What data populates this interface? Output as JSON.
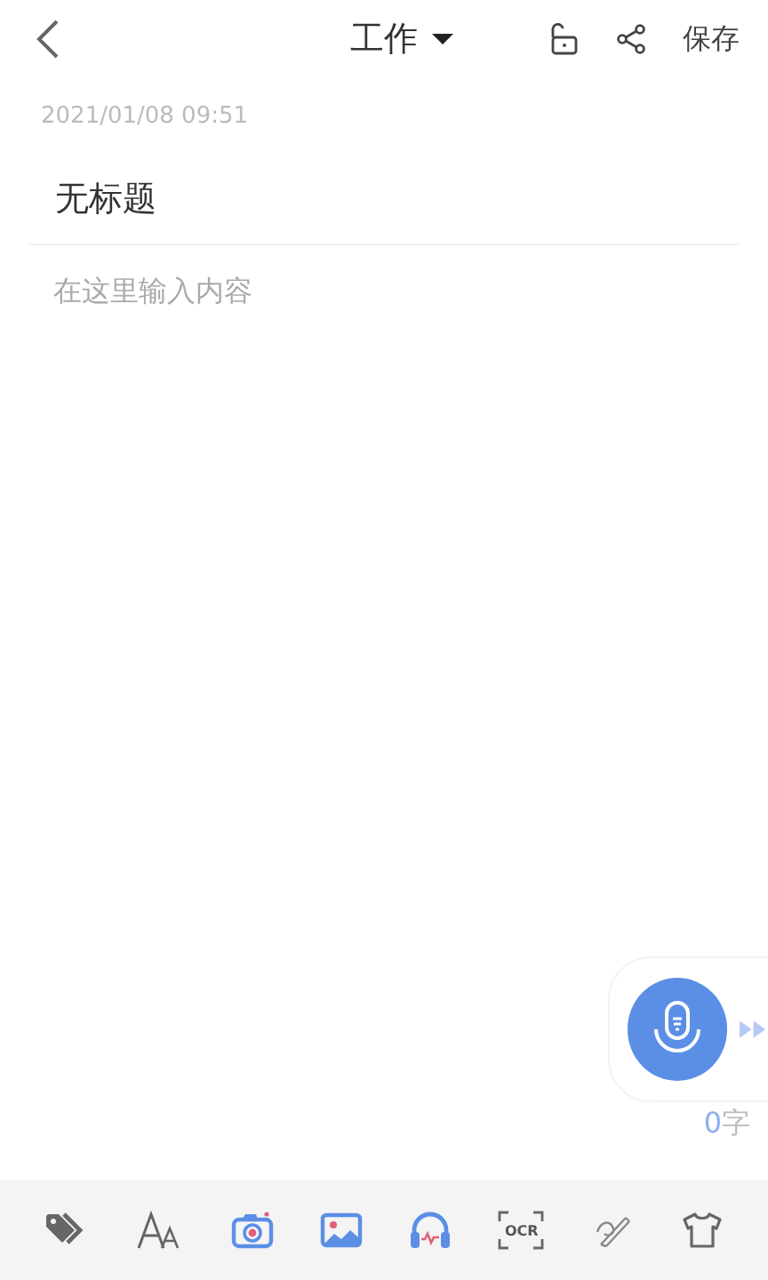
{
  "header": {
    "category": "工作",
    "save": "保存",
    "locked": false
  },
  "date": "2021/01/08 09:51",
  "title": "无标题",
  "content": {
    "placeholder": "在这里输入内容"
  },
  "word_count": {
    "value": "0",
    "unit": "字"
  },
  "toolbar": [
    {
      "kind": "tag"
    },
    {
      "kind": "font"
    },
    {
      "kind": "camera"
    },
    {
      "kind": "image"
    },
    {
      "kind": "audio"
    },
    {
      "kind": "ocr",
      "label": "OCR"
    },
    {
      "kind": "handwriting"
    },
    {
      "kind": "theme"
    }
  ]
}
